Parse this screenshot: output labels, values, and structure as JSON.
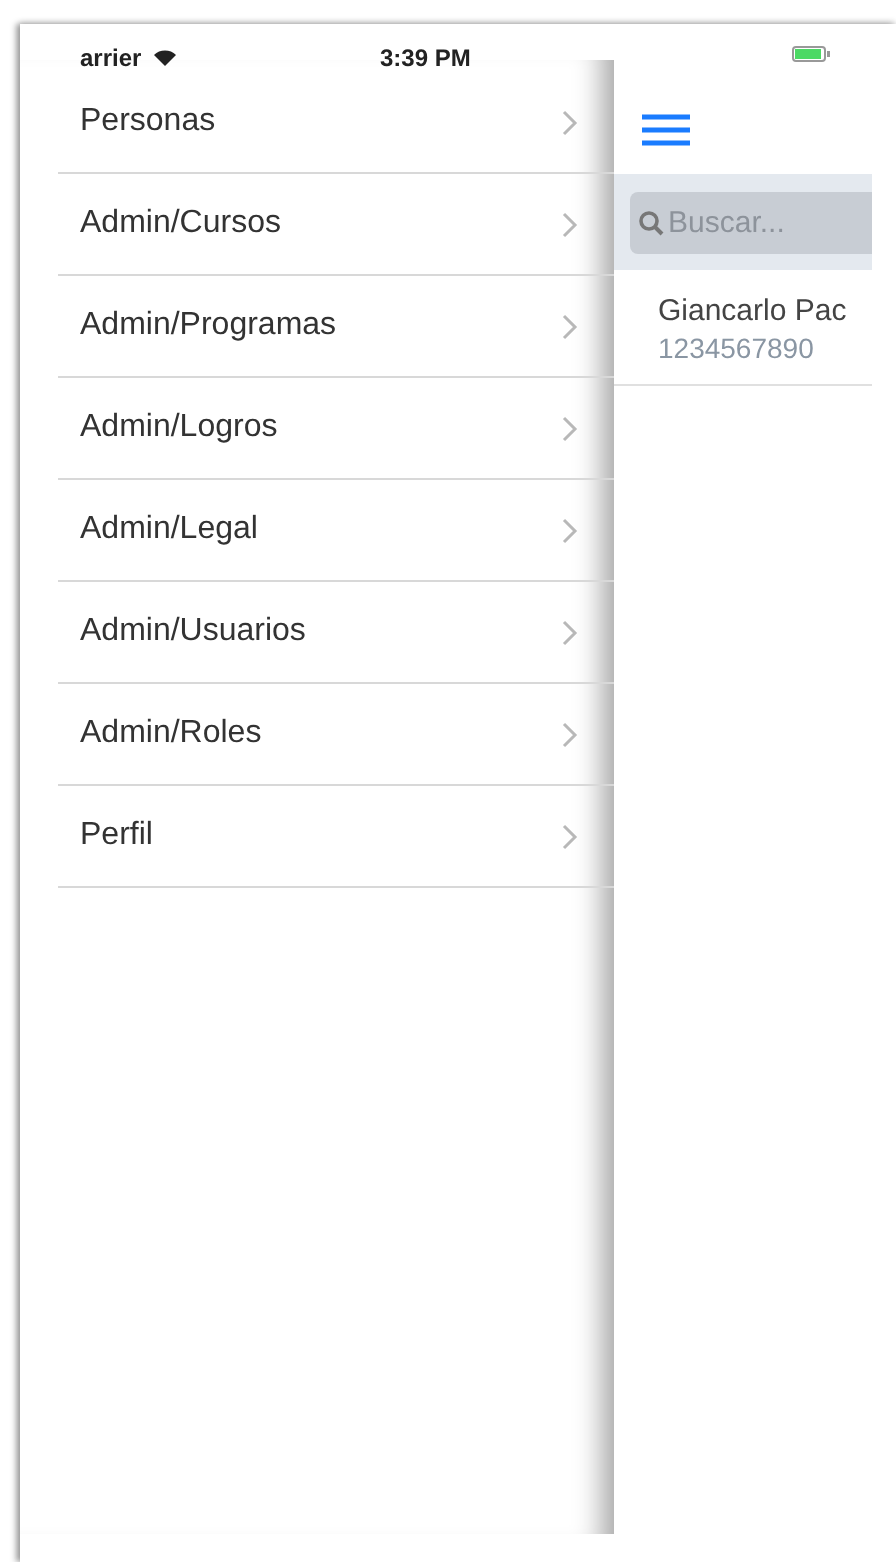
{
  "status_bar": {
    "carrier": "arrier",
    "time": "3:39 PM"
  },
  "drawer": {
    "items": [
      {
        "label": "Personas"
      },
      {
        "label": "Admin/Cursos"
      },
      {
        "label": "Admin/Programas"
      },
      {
        "label": "Admin/Logros"
      },
      {
        "label": "Admin/Legal"
      },
      {
        "label": "Admin/Usuarios"
      },
      {
        "label": "Admin/Roles"
      },
      {
        "label": "Perfil"
      }
    ]
  },
  "main": {
    "search": {
      "placeholder": "Buscar..."
    },
    "list": [
      {
        "name": "Giancarlo Pac",
        "phone": "1234567890"
      }
    ]
  }
}
